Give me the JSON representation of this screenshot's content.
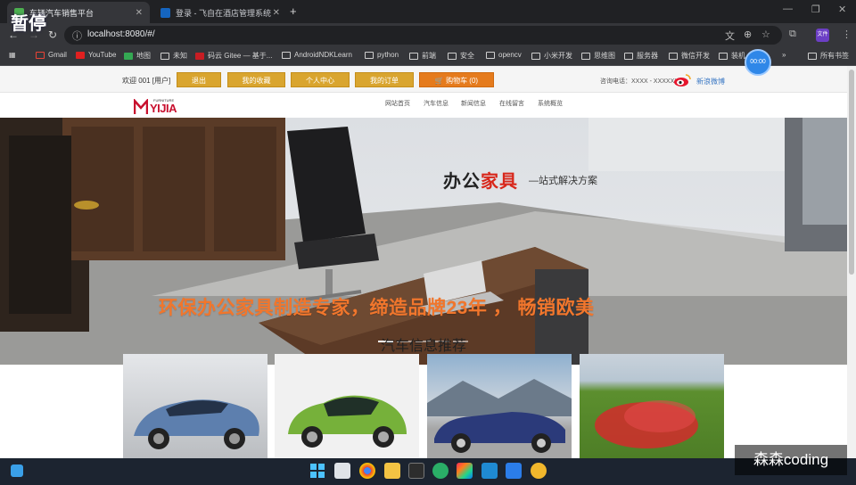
{
  "browser": {
    "tabs": [
      {
        "label": "车辆汽车销售平台",
        "active": true
      },
      {
        "label": "登录 - 飞自在酒店管理系统",
        "active": false
      }
    ],
    "new_tab": "+",
    "url": "localhost:8080/#/",
    "bookmarks": [
      "Gmail",
      "YouTube",
      "地图",
      "未知",
      "码云 Gitee — 基于...",
      "AndroidNDKLearn",
      "python",
      "前端",
      "安全",
      "opencv",
      "小米开发",
      "思维图",
      "服务器",
      "微信开发",
      "装机",
      "所有书签"
    ],
    "more": "»",
    "profile": "文件"
  },
  "site": {
    "welcome": "欢迎 001 [用户]",
    "top_buttons": [
      "退出",
      "我的收藏",
      "个人中心",
      "我的订单",
      "🛒 购物车 (0)"
    ],
    "hotline": "咨询电话：XXXX - XXXXXX",
    "weibo": "新浪微博",
    "logo": {
      "top": "FURNITURE",
      "main": "YIJIA"
    },
    "menu": [
      "网站首页",
      "汽车信息",
      "新闻信息",
      "在线留言",
      "系统概览"
    ]
  },
  "hero": {
    "title_black": "办公",
    "title_red": "家具",
    "subtitle": "—站式解决方案",
    "slogan": "环保办公家具制造专家，缔造品牌23年 ， 畅销欧美",
    "dots": 5,
    "active_dot": 0
  },
  "section": {
    "title": "汽车信息推荐"
  },
  "overlay": {
    "pause": "暂停",
    "timer": "00:00",
    "watermark": "森森coding"
  },
  "colors": {
    "gold": "#d9a52f",
    "orange": "#e57b1d",
    "red": "#d8271b",
    "chrome": "#35363a"
  }
}
